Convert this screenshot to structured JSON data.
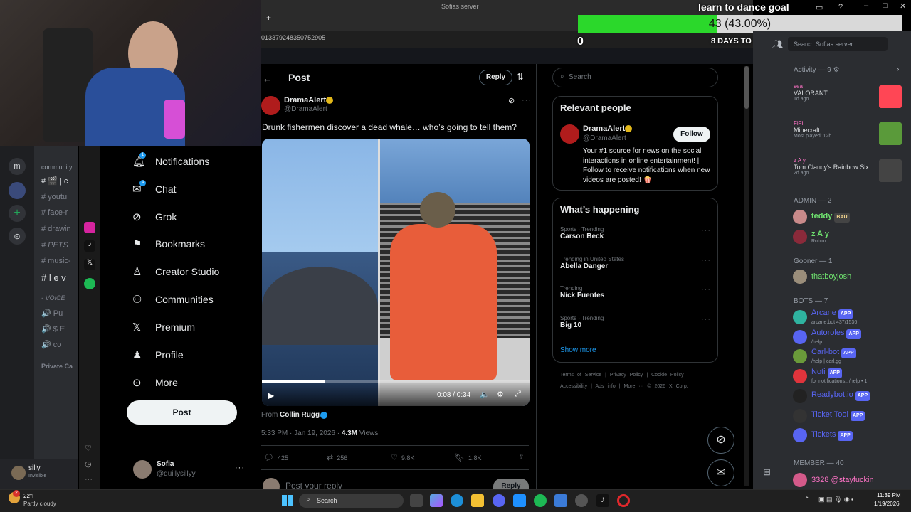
{
  "overlay": {
    "goal_title": "learn to dance goal",
    "goal_value": "43 (43.00%)",
    "goal_progress": 0.43,
    "goal_min": "0",
    "goal_max": "100",
    "days_to_go": "8 DAYS TO GO"
  },
  "browser": {
    "window_title": "Sofias server",
    "url_fragment": "013379248350752905"
  },
  "discord_left": {
    "server_letter": "m",
    "category": "community",
    "channels": [
      "# 🎬 | c",
      "# youtu",
      "# face-r",
      "# drawin",
      "# PETS",
      "# music-",
      "# l e v"
    ],
    "voice_label": "- VOICE",
    "voice_channels": [
      "🔊 Pu",
      "🔊 $ E",
      "🔊 co"
    ],
    "private_label": "Private Ca",
    "user_name": "silly",
    "user_status": "Invisible"
  },
  "x_nav": {
    "items": [
      {
        "label": "Notifications",
        "icon": "bell-icon",
        "badge": "1"
      },
      {
        "label": "Chat",
        "icon": "chat-icon",
        "badge": "4"
      },
      {
        "label": "Grok",
        "icon": "grok-icon"
      },
      {
        "label": "Bookmarks",
        "icon": "bookmark-icon"
      },
      {
        "label": "Creator Studio",
        "icon": "creator-icon"
      },
      {
        "label": "Communities",
        "icon": "communities-icon"
      },
      {
        "label": "Premium",
        "icon": "x-logo-icon"
      },
      {
        "label": "Profile",
        "icon": "person-icon"
      },
      {
        "label": "More",
        "icon": "more-circle-icon"
      }
    ],
    "post_button": "Post",
    "account_name": "Sofia",
    "account_handle": "@quillysillyy"
  },
  "x_post": {
    "header": "Post",
    "reply_button": "Reply",
    "author_name": "DramaAlert",
    "author_handle": "@DramaAlert",
    "text": "Drunk fishermen discover a dead whale… who’s going to tell them?",
    "video_time": "0:08 / 0:34",
    "video_progress": 0.235,
    "from_label": "From",
    "from_name": "Collin Rugg",
    "timestamp": "5:33 PM · Jan 19, 2026 · ",
    "views_count": "4.3M",
    "views_label": " Views",
    "replies": "425",
    "reposts": "256",
    "likes": "9.8K",
    "bookmarks": "1.8K",
    "reply_placeholder": "Post your reply",
    "reply_btn2": "Reply"
  },
  "x_side": {
    "search_placeholder": "Search",
    "relevant_title": "Relevant people",
    "rp_name": "DramaAlert",
    "rp_handle": "@DramaAlert",
    "follow_button": "Follow",
    "rp_bio": "Your #1 source for news on the social interactions in online entertainment! | Follow to receive notifications when new videos are posted! 🍿",
    "happening_title": "What’s happening",
    "trends": [
      {
        "meta": "Sports · Trending",
        "name": "Carson Beck"
      },
      {
        "meta": "Trending in United States",
        "name": "Abella Danger"
      },
      {
        "meta": "Trending",
        "name": "Nick Fuentes"
      },
      {
        "meta": "Sports · Trending",
        "name": "Big 10"
      }
    ],
    "show_more": "Show more",
    "footer1": [
      "Terms of Service",
      "|",
      "Privacy Policy",
      "|",
      "Cookie Policy",
      "|"
    ],
    "footer2": [
      "Accessibility",
      "|",
      "Ads info",
      "|",
      "More ···",
      "© 2026 X Corp."
    ]
  },
  "discord_right": {
    "search_placeholder": "Search Sofias server",
    "activity_header": "Activity — 9",
    "activities": [
      {
        "user": "sea",
        "game": "VALORANT",
        "time": "1d ago"
      },
      {
        "user": "FiFi",
        "game": "Minecraft",
        "time": "Most played: 12h"
      },
      {
        "user": "z A y",
        "game": "Tom Clancy's Rainbow Six ...",
        "time": "2d ago"
      }
    ],
    "admin_header": "ADMIN — 2",
    "admins": [
      {
        "name": "teddy",
        "tag": "BAU"
      },
      {
        "name": "z A y",
        "sub": "Roblox"
      }
    ],
    "gooner_header": "Gooner — 1",
    "gooners": [
      {
        "name": "thatboyjosh"
      }
    ],
    "bots_header": "BOTS — 7",
    "bots": [
      {
        "name": "Arcane",
        "sub": "arcane.bot 437/1536"
      },
      {
        "name": "Autoroles",
        "sub": "/help"
      },
      {
        "name": "Carl-bot",
        "sub": "/help | carl.gg"
      },
      {
        "name": "Noti",
        "sub": "for notifications.. /help • 1"
      },
      {
        "name": "Readybot.io",
        "sub": ""
      },
      {
        "name": "Ticket Tool",
        "sub": ""
      },
      {
        "name": "Tickets",
        "sub": ""
      }
    ],
    "app_tag": "APP",
    "member_header": "MEMBER — 40",
    "members": [
      {
        "name": "3328 @stayfuckin"
      }
    ]
  },
  "taskbar": {
    "weather_temp": "22°F",
    "weather_desc": "Partly cloudy",
    "weather_badge": "2",
    "search_label": "Search",
    "time": "11:39 PM",
    "date": "1/19/2026"
  },
  "colors": {
    "x_blue": "#1d9bf0",
    "discord_bg": "#2b2d31",
    "goal_green": "#2bd82b",
    "app_blue": "#5865f2"
  }
}
